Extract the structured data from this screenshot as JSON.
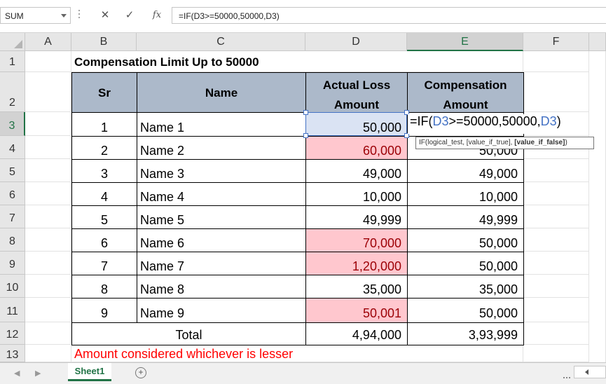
{
  "formula_bar": {
    "name_box": "SUM",
    "cancel_icon": "✕",
    "enter_icon": "✓",
    "fx_label": "fx",
    "formula": "=IF(D3>=50000,50000,D3)"
  },
  "columns": [
    "A",
    "B",
    "C",
    "D",
    "E",
    "F"
  ],
  "rows": [
    "1",
    "2",
    "3",
    "4",
    "5",
    "6",
    "7",
    "8",
    "9",
    "10",
    "11",
    "12",
    "13"
  ],
  "sheet": {
    "title": "Compensation Limit Up to 50000",
    "headers": {
      "sr": "Sr",
      "name": "Name",
      "actual_line1": "Actual Loss",
      "actual_line2": "Amount",
      "comp_line1": "Compensation",
      "comp_line2": "Amount"
    },
    "data": [
      {
        "sr": "1",
        "name": "Name 1",
        "actual": "50,000",
        "comp": "",
        "highlight": false
      },
      {
        "sr": "2",
        "name": "Name 2",
        "actual": "60,000",
        "comp": "50,000",
        "highlight": true
      },
      {
        "sr": "3",
        "name": "Name 3",
        "actual": "49,000",
        "comp": "49,000",
        "highlight": false
      },
      {
        "sr": "4",
        "name": "Name 4",
        "actual": "10,000",
        "comp": "10,000",
        "highlight": false
      },
      {
        "sr": "5",
        "name": "Name 5",
        "actual": "49,999",
        "comp": "49,999",
        "highlight": false
      },
      {
        "sr": "6",
        "name": "Name 6",
        "actual": "70,000",
        "comp": "50,000",
        "highlight": true
      },
      {
        "sr": "7",
        "name": "Name 7",
        "actual": "1,20,000",
        "comp": "50,000",
        "highlight": true
      },
      {
        "sr": "8",
        "name": "Name 8",
        "actual": "35,000",
        "comp": "35,000",
        "highlight": false
      },
      {
        "sr": "9",
        "name": "Name 9",
        "actual": "50,001",
        "comp": "50,000",
        "highlight": true
      }
    ],
    "total_label": "Total",
    "total_actual": "4,94,000",
    "total_comp": "3,93,999",
    "note": "Amount considered whichever is lesser"
  },
  "in_cell_edit": {
    "p1": "=IF(",
    "ref1": "D3",
    "p2": ">=50000,50000,",
    "ref2": "D3",
    "p3": ")"
  },
  "tooltip": {
    "text1": "IF(logical_test, [value_if_true], ",
    "bold": "[value_if_false]",
    "text2": ")"
  },
  "tabs": {
    "sheet1": "Sheet1",
    "add_icon": "+"
  },
  "colors": {
    "header_fill": "#acb9ca",
    "highlight_fill": "#ffc7ce",
    "highlight_text": "#9c0006",
    "note_text": "#ff0000",
    "selection": "#4472c4",
    "excel_green": "#217346"
  }
}
